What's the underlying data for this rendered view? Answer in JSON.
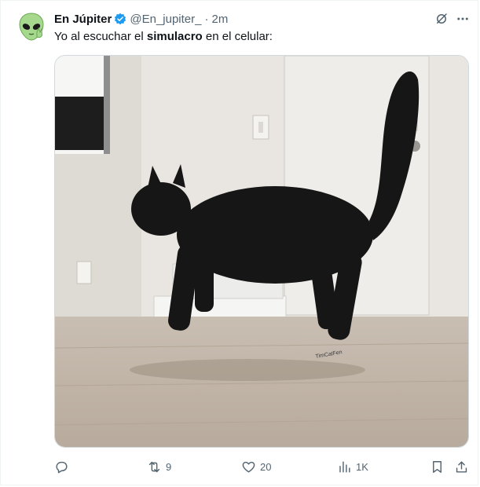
{
  "tweet": {
    "author_name": "En Júpiter",
    "handle": "@En_jupiter_",
    "separator": "·",
    "time": "2m",
    "text_before": "Yo al escuchar el ",
    "text_bold": "simulacro",
    "text_after": " en el celular:",
    "avatar_icon": "alien-emoji-icon",
    "verified_icon": "verified-badge-icon",
    "image_watermark": "TimCatFen"
  },
  "actions": {
    "reply_count": "",
    "retweet_count": "9",
    "like_count": "20",
    "views_count": "1K"
  },
  "colors": {
    "verified": "#1d9bf0",
    "secondary_text": "#536471",
    "avatar_green": "#a6d98e"
  }
}
